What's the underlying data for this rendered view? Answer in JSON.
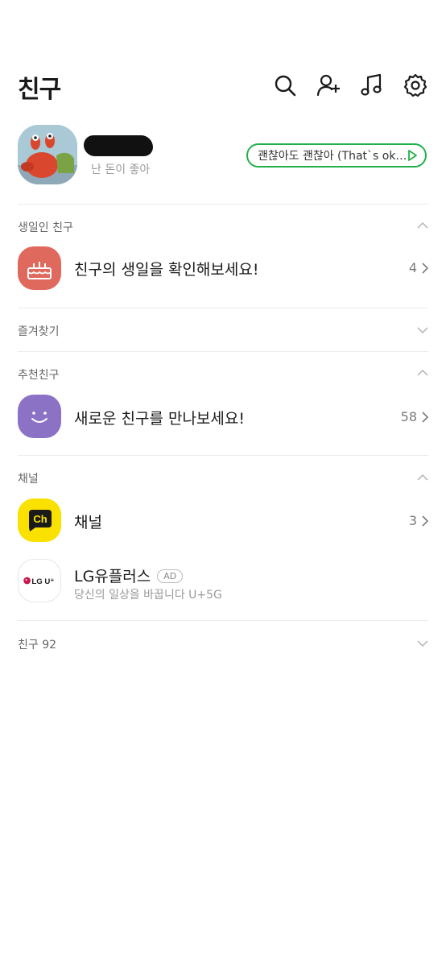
{
  "header": {
    "title": "친구"
  },
  "icons": {
    "search": "search-icon",
    "add_friend": "add-friend-icon",
    "music": "music-icon",
    "settings": "gear-icon"
  },
  "profile": {
    "status": "난 돈이 좋아",
    "music": "괜찮아도 괜찮아 (That`s ok…"
  },
  "sections": {
    "birthday": {
      "header": "생일인 친구",
      "label": "친구의 생일을 확인해보세요!",
      "count": "4"
    },
    "favorites": {
      "header": "즐겨찾기"
    },
    "recommended": {
      "header": "추천친구",
      "label": "새로운 친구를 만나보세요!",
      "count": "58"
    },
    "channel": {
      "header": "채널",
      "channel_label": "채널",
      "channel_icon_text": "Ch",
      "channel_count": "3",
      "ad_name": "LG유플러스",
      "ad_badge": "AD",
      "ad_desc": "당신의 일상을 바꿉니다 U+5G",
      "ad_logo_text": "LG U⁺"
    },
    "friends": {
      "header": "친구 92"
    }
  },
  "colors": {
    "accent_green": "#22b04a",
    "birthday": "#e0695e",
    "recommend": "#8b72c4",
    "channel": "#fae100"
  }
}
